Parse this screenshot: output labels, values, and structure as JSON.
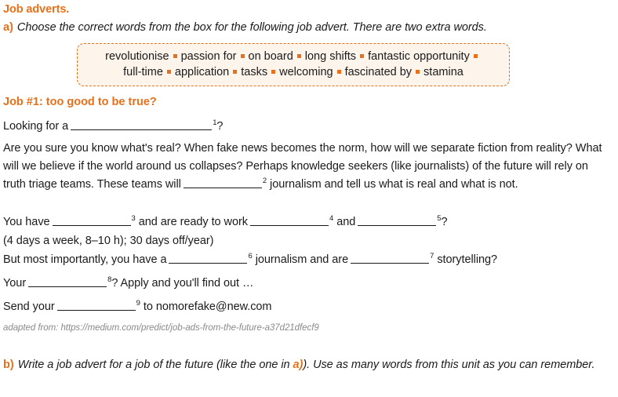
{
  "worksheet": {
    "title": "Job adverts.",
    "accent_color": "#e8701a",
    "text_color": "#1a1a1a",
    "source_color": "#8a8a8a",
    "box_fill_color": "#fdf4ec"
  },
  "task_a": {
    "letter": "a)",
    "instruction": "Choose the correct words from the box for the following job advert. There are two extra words."
  },
  "word_box": {
    "line1": [
      "revolutionise",
      "passion for",
      "on board",
      "long shifts",
      "fantastic opportunity"
    ],
    "line2": [
      "full-time",
      "application",
      "tasks",
      "welcoming",
      "fascinated by",
      "stamina"
    ]
  },
  "advert": {
    "heading": "Job #1: too good to be true?",
    "line_looking_pre": "Looking for a",
    "line_looking_num": "1",
    "line_looking_post": "?",
    "paragraph": "Are you sure you know what's real? When fake news becomes the norm, how will we separate fiction from reality? What will we believe if the world around us collapses? Perhaps knowledge seekers (like journalists)",
    "para2_pre": "of the future will rely on truth triage teams. These teams will",
    "para2_num": "2",
    "para2_post": "journalism and tell us what is real and what is not.",
    "youhave_pre": "You have",
    "youhave_num": "3",
    "youhave_mid": "and are ready to work",
    "youhave_num2": "4",
    "youhave_mid2": "and",
    "youhave_num3": "5",
    "youhave_post": "?",
    "days_line": "(4 days a week, 8–10 h); 30 days off/year)",
    "most_pre": "But most importantly, you have a",
    "most_num": "6",
    "most_mid": "journalism and are",
    "most_num2": "7",
    "most_post": "storytelling?",
    "your_pre": "Your",
    "your_num": "8",
    "your_post": "? Apply and you'll find out …",
    "send_pre": "Send your",
    "send_num": "9",
    "send_post": "to nomorefake@new.com"
  },
  "source": {
    "text": "adapted from: https://medium.com/predict/job-ads-from-the-future-a37d21dfecf9"
  },
  "task_b": {
    "letter": "b)",
    "text_before_ref": "Write a job advert for a job of the future (like the one in",
    "ref": "a)",
    "text_after_ref": "). Use as many words from this unit as you can remember."
  }
}
